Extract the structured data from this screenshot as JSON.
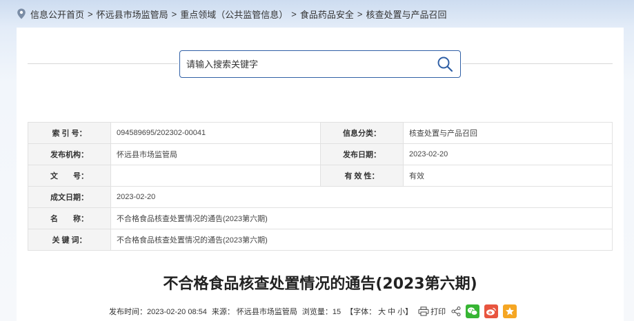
{
  "breadcrumb": {
    "items": [
      "信息公开首页",
      "怀远县市场监管局",
      "重点领域（公共监管信息）",
      "食品药品安全",
      "核查处置与产品召回"
    ],
    "separator": ">"
  },
  "search": {
    "placeholder": "请输入搜索关键字"
  },
  "meta": {
    "index_label": "索 引 号：",
    "index_value": "094589695/202302-00041",
    "category_label": "信息分类：",
    "category_value": "核查处置与产品召回",
    "publisher_label": "发布机构：",
    "publisher_value": "怀远县市场监管局",
    "publish_date_label": "发布日期：",
    "publish_date_value": "2023-02-20",
    "doc_no_label": "文　　号：",
    "doc_no_value": "",
    "validity_label": "有 效 性：",
    "validity_value": "有效",
    "created_date_label": "成文日期：",
    "created_date_value": "2023-02-20",
    "name_label": "名　　称：",
    "name_value": "不合格食品核查处置情况的通告(2023第六期)",
    "keywords_label": "关 键 词：",
    "keywords_value": "不合格食品核查处置情况的通告(2023第六期)"
  },
  "article": {
    "title": "不合格食品核查处置情况的通告(2023第六期)",
    "publish_time": "发布时间：2023-02-20 08:54",
    "source": "来源： 怀远县市场监管局",
    "views": "浏览量：15",
    "font_label": "【字体：",
    "font_large": "大",
    "font_medium": "中",
    "font_small": "小",
    "font_close": "】",
    "print_label": "打印"
  },
  "colors": {
    "accent": "#2f5fa5",
    "wechat": "#36b533",
    "weibo": "#e8553f",
    "favorite": "#f5a623"
  }
}
